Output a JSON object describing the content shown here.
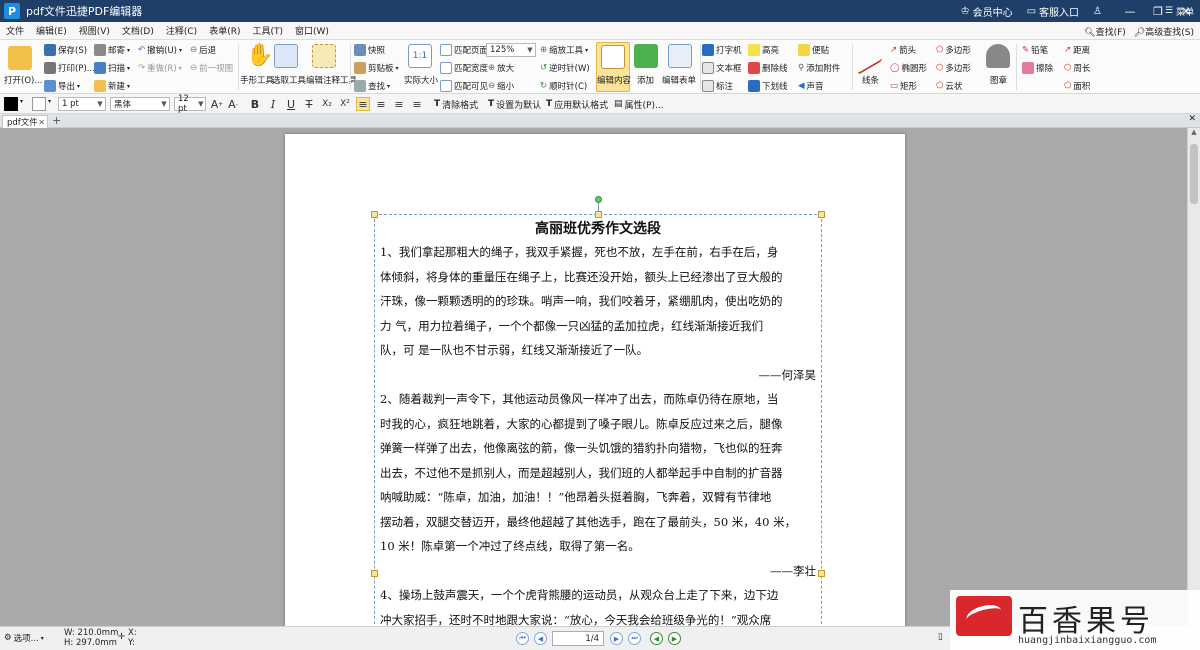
{
  "window": {
    "app_logo": "P",
    "title": "pdf文件迅捷PDF编辑器",
    "member_center": "会员中心",
    "customer_service": "客服入口"
  },
  "menubar": {
    "items": [
      "文件",
      "编辑(E)",
      "视图(V)",
      "文档(D)",
      "注释(C)",
      "表单(R)",
      "工具(T)",
      "窗口(W)"
    ],
    "find": "查找(F)",
    "advanced_find": "高级查找(S)",
    "menu": "菜单"
  },
  "ribbon": {
    "open": "打开(O)...",
    "save": "保存(S)",
    "print": "打印(P)...",
    "export": "导出",
    "mail": "邮寄",
    "scan": "扫描",
    "new": "新建",
    "undo": "撤销(U)",
    "redo": "重做(R)",
    "back": "后退",
    "prev_view": "前一视图",
    "hand_tool": "手形工具",
    "select_tool": "选取工具",
    "edit_annot_tool": "编辑注释工具",
    "snapshot": "快照",
    "clipboard": "剪贴板",
    "find": "查找",
    "actual_size": "实际大小",
    "fit_page": "匹配页面",
    "fit_width": "匹配宽度",
    "fit_visible": "匹配可见",
    "zoom_value": "125%",
    "zoom_tool": "缩放工具",
    "zoom_in": "放大",
    "zoom_out": "缩小",
    "rotate_ccw": "逆时针(W)",
    "rotate_cw": "顺时针(C)",
    "edit_content": "编辑内容",
    "add": "添加",
    "edit_form": "编辑表单",
    "typewriter": "打字机",
    "textbox": "文本框",
    "callout": "标注",
    "highlight": "高亮",
    "strikeout": "删除线",
    "underline": "下划线",
    "note": "便贴",
    "attachment": "添加附件",
    "sound": "声音",
    "line": "线条",
    "arrow": "箭头",
    "ellipse": "椭圆形",
    "rect": "矩形",
    "polygon": "多边形",
    "polyline": "多边形",
    "cloud": "云状",
    "stamp": "图章",
    "pencil": "铅笔",
    "eraser": "擦除",
    "distance": "距离",
    "perimeter": "周长",
    "area": "面积"
  },
  "formatbar": {
    "line_width": "1 pt",
    "font_name": "黑体",
    "font_size": "12 pt",
    "clear_format": "清除格式",
    "set_default": "设置为默认",
    "apply_default": "应用默认格式",
    "properties": "属性(P)..."
  },
  "tabs": [
    {
      "label": "pdf文件"
    }
  ],
  "document": {
    "title": "高丽班优秀作文选段",
    "lines": [
      "1、我们拿起那粗大的绳子，我双手紧握，死也不放，左手在前，右手在后，身",
      "体倾斜，将身体的重量压在绳子上，比赛还没开始，额头上已经渗出了豆大般的",
      "汗珠，像一颗颗透明的的珍珠。哨声一响，我们咬着牙，紧绷肌肉，使出吃奶的",
      "力 气，用力拉着绳子，一个个都像一只凶猛的孟加拉虎，红线渐渐接近我们",
      "队，可 是一队也不甘示弱，红线又渐渐接近了一队。"
    ],
    "sign1": "——何泽昊",
    "lines2": [
      "2、随着裁判一声令下，其他运动员像风一样冲了出去，而陈卓仍待在原地，当",
      "时我的心，疯狂地跳着，大家的心都提到了嗓子眼儿。陈卓反应过来之后，腿像",
      "弹簧一样弹了出去，他像离弦的箭，像一头饥饿的猎豹扑向猎物，飞也似的狂奔",
      "出去，不过他不是抓别人，而是超越别人，我们班的人都举起手中自制的扩音器",
      "呐喊助威：“陈卓，加油，加油！！”他昂着头挺着胸，飞奔着，双臂有节律地",
      "摆动着，双腿交替迈开，最终他超越了其他选手，跑在了最前头，50 米，40 米，",
      "10 米！陈卓第一个冲过了终点线，取得了第一名。"
    ],
    "sign2": "——李壮",
    "lines3": [
      "4、操场上鼓声震天，一个个虎背熊腰的运动员，从观众台上走了下来，边下边",
      "冲大家招手，还时不时地跟大家说：“放心，今天我会给班级争光的！”观众席"
    ]
  },
  "statusbar": {
    "options": "选项...",
    "width": "W: 210.0mm",
    "height": "H: 297.0mm",
    "x": "X:",
    "y": "Y:",
    "page_indicator": "1/4"
  },
  "watermark": {
    "brand": "百香果号",
    "url": "huangjinbaixiangguo.com"
  },
  "colors": {
    "titlebar": "#1f3f68",
    "accent": "#1e8de0",
    "workspace": "#a9a9a9",
    "active_tool": "#fbe39a"
  }
}
